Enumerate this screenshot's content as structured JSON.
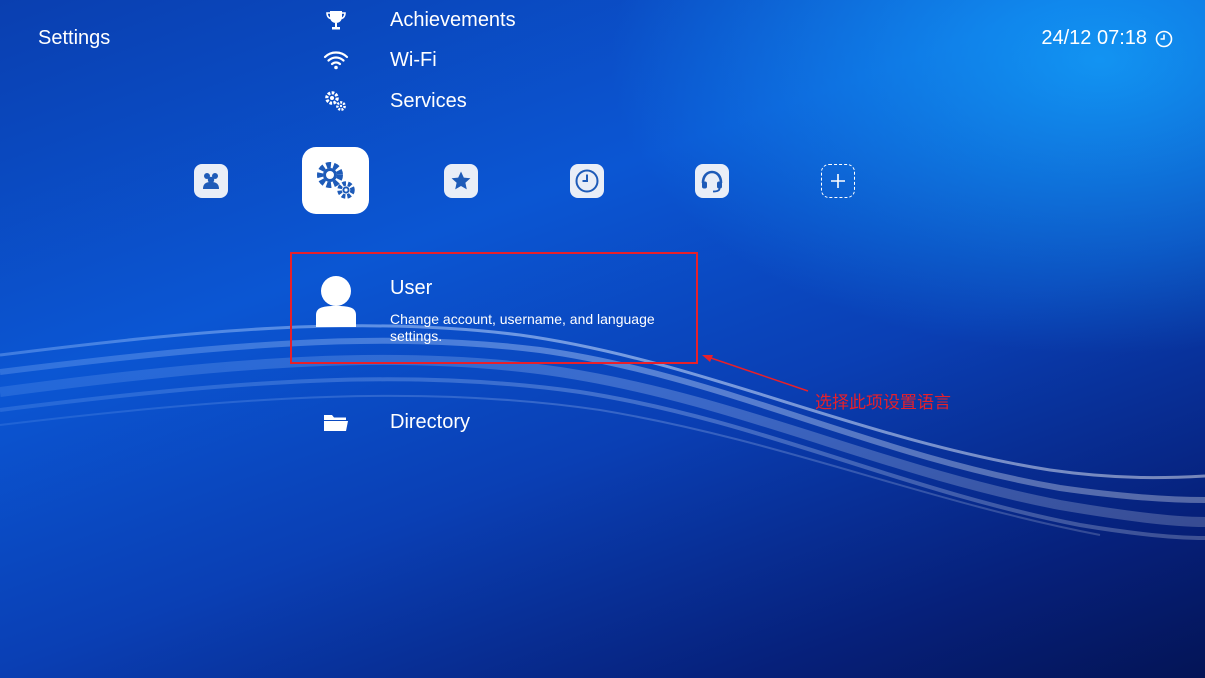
{
  "header": {
    "title": "Settings",
    "datetime": "24/12 07:18",
    "clock_icon": "clock-icon"
  },
  "menu": {
    "items_above": [
      {
        "label": "Achievements",
        "icon": "trophy-icon"
      },
      {
        "label": "Wi-Fi",
        "icon": "wifi-icon"
      },
      {
        "label": "Services",
        "icon": "gears-icon"
      }
    ],
    "selected": {
      "label": "User",
      "description": "Change account, username, and language settings.",
      "icon": "user-icon"
    },
    "items_below": [
      {
        "label": "Directory",
        "icon": "folder-icon"
      }
    ]
  },
  "categories": [
    {
      "name": "social",
      "icon": "people-icon"
    },
    {
      "name": "settings",
      "icon": "settings-gears-icon",
      "selected": true
    },
    {
      "name": "favorites",
      "icon": "star-icon"
    },
    {
      "name": "history",
      "icon": "history-clock-icon"
    },
    {
      "name": "support",
      "icon": "headset-icon"
    },
    {
      "name": "add",
      "icon": "plus-icon"
    }
  ],
  "annotation": {
    "text": "选择此项设置语言",
    "color": "#e8202a"
  },
  "colors": {
    "background_top": "#0b56d3",
    "background_bottom": "#041456",
    "accent_blue": "#1e5bb8",
    "highlight_red": "#e8202a"
  }
}
